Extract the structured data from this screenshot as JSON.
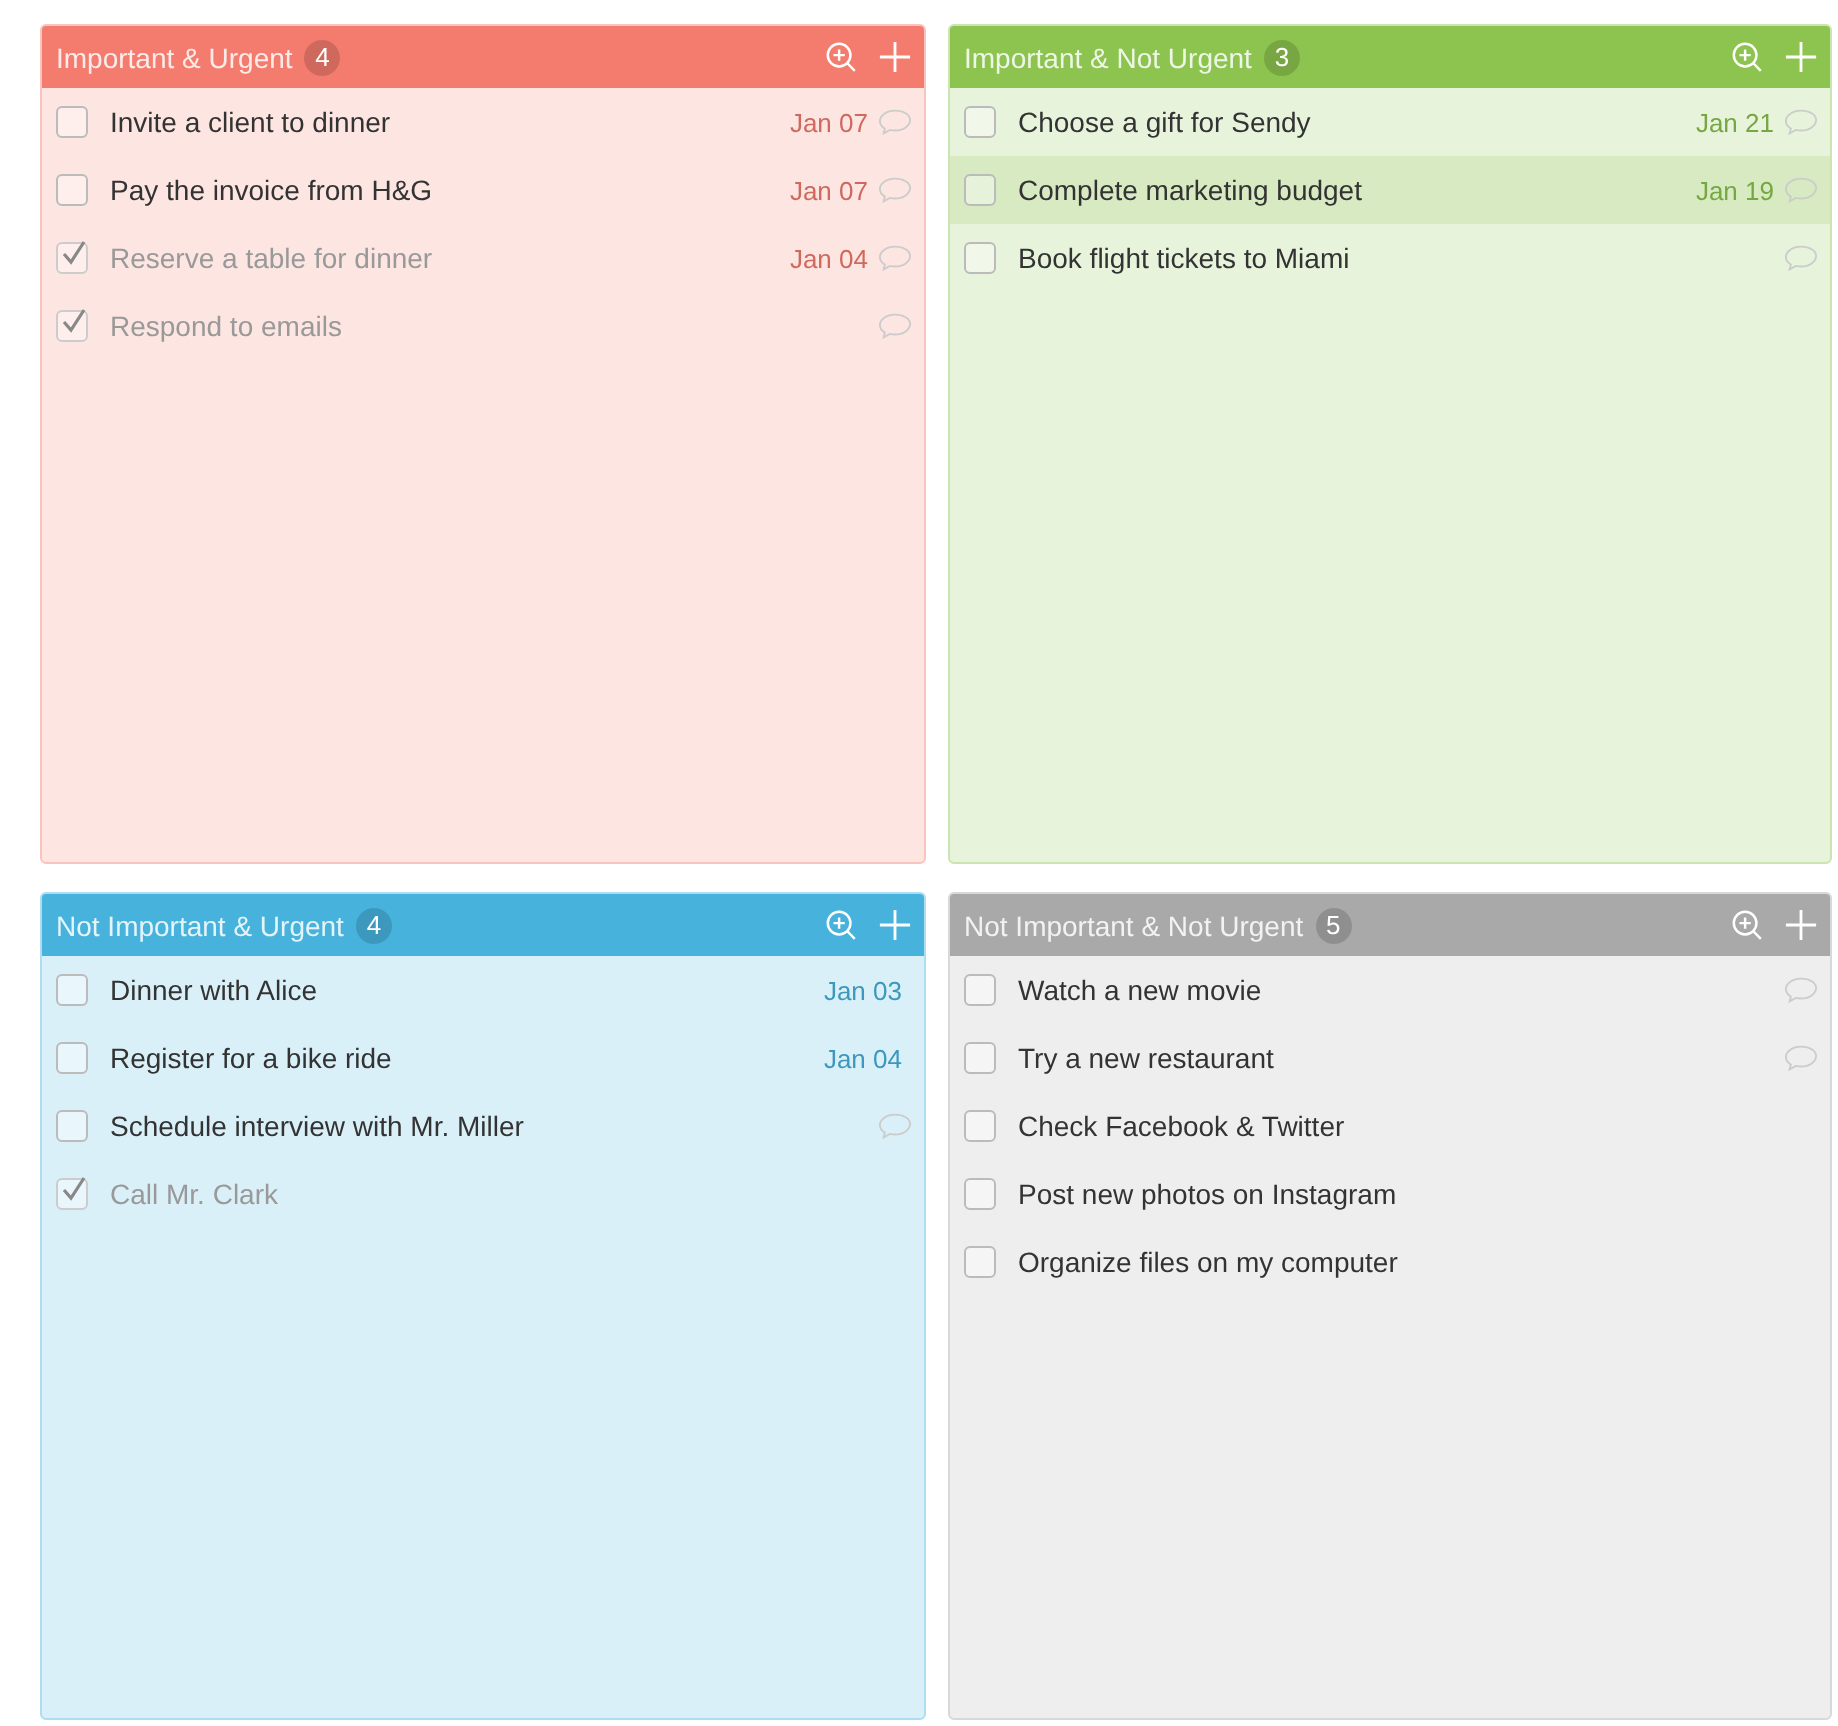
{
  "quadrants": [
    {
      "title": "Important & Urgent",
      "count": "4",
      "color": "#f47c6e",
      "tasks": [
        {
          "text": "Invite a client to dinner",
          "checked": false,
          "date": "Jan 07",
          "comment": true,
          "selected": false
        },
        {
          "text": "Pay the invoice from H&G",
          "checked": false,
          "date": "Jan 07",
          "comment": true,
          "selected": false
        },
        {
          "text": "Reserve a table for dinner",
          "checked": true,
          "date": "Jan 04",
          "comment": true,
          "selected": false
        },
        {
          "text": "Respond to emails",
          "checked": true,
          "comment": true,
          "selected": false
        }
      ]
    },
    {
      "title": "Important & Not Urgent",
      "count": "3",
      "color": "#8cc44f",
      "tasks": [
        {
          "text": "Choose a gift for Sendy",
          "checked": false,
          "date": "Jan 21",
          "comment": true,
          "selected": false
        },
        {
          "text": "Complete marketing budget",
          "checked": false,
          "date": "Jan 19",
          "comment": true,
          "selected": true
        },
        {
          "text": "Book flight tickets to Miami",
          "checked": false,
          "comment": true,
          "selected": false
        }
      ]
    },
    {
      "title": "Not Important & Urgent",
      "count": "4",
      "color": "#47b3dd",
      "tasks": [
        {
          "text": "Dinner with Alice",
          "checked": false,
          "date": "Jan 03",
          "comment": false,
          "selected": false
        },
        {
          "text": "Register for a bike ride",
          "checked": false,
          "date": "Jan 04",
          "comment": false,
          "selected": false
        },
        {
          "text": "Schedule interview with Mr. Miller",
          "checked": false,
          "comment": true,
          "selected": false
        },
        {
          "text": "Call Mr. Clark",
          "checked": true,
          "comment": false,
          "selected": false
        }
      ]
    },
    {
      "title": "Not Important & Not Urgent",
      "count": "5",
      "color": "#a9a9a9",
      "tasks": [
        {
          "text": "Watch a new movie",
          "checked": false,
          "comment": true,
          "selected": false
        },
        {
          "text": "Try a new restaurant",
          "checked": false,
          "comment": true,
          "selected": false
        },
        {
          "text": "Check Facebook & Twitter",
          "checked": false,
          "comment": false,
          "selected": false
        },
        {
          "text": "Post new photos on Instagram",
          "checked": false,
          "comment": false,
          "selected": false
        },
        {
          "text": "Organize files on my computer",
          "checked": false,
          "comment": false,
          "selected": false
        }
      ]
    }
  ]
}
